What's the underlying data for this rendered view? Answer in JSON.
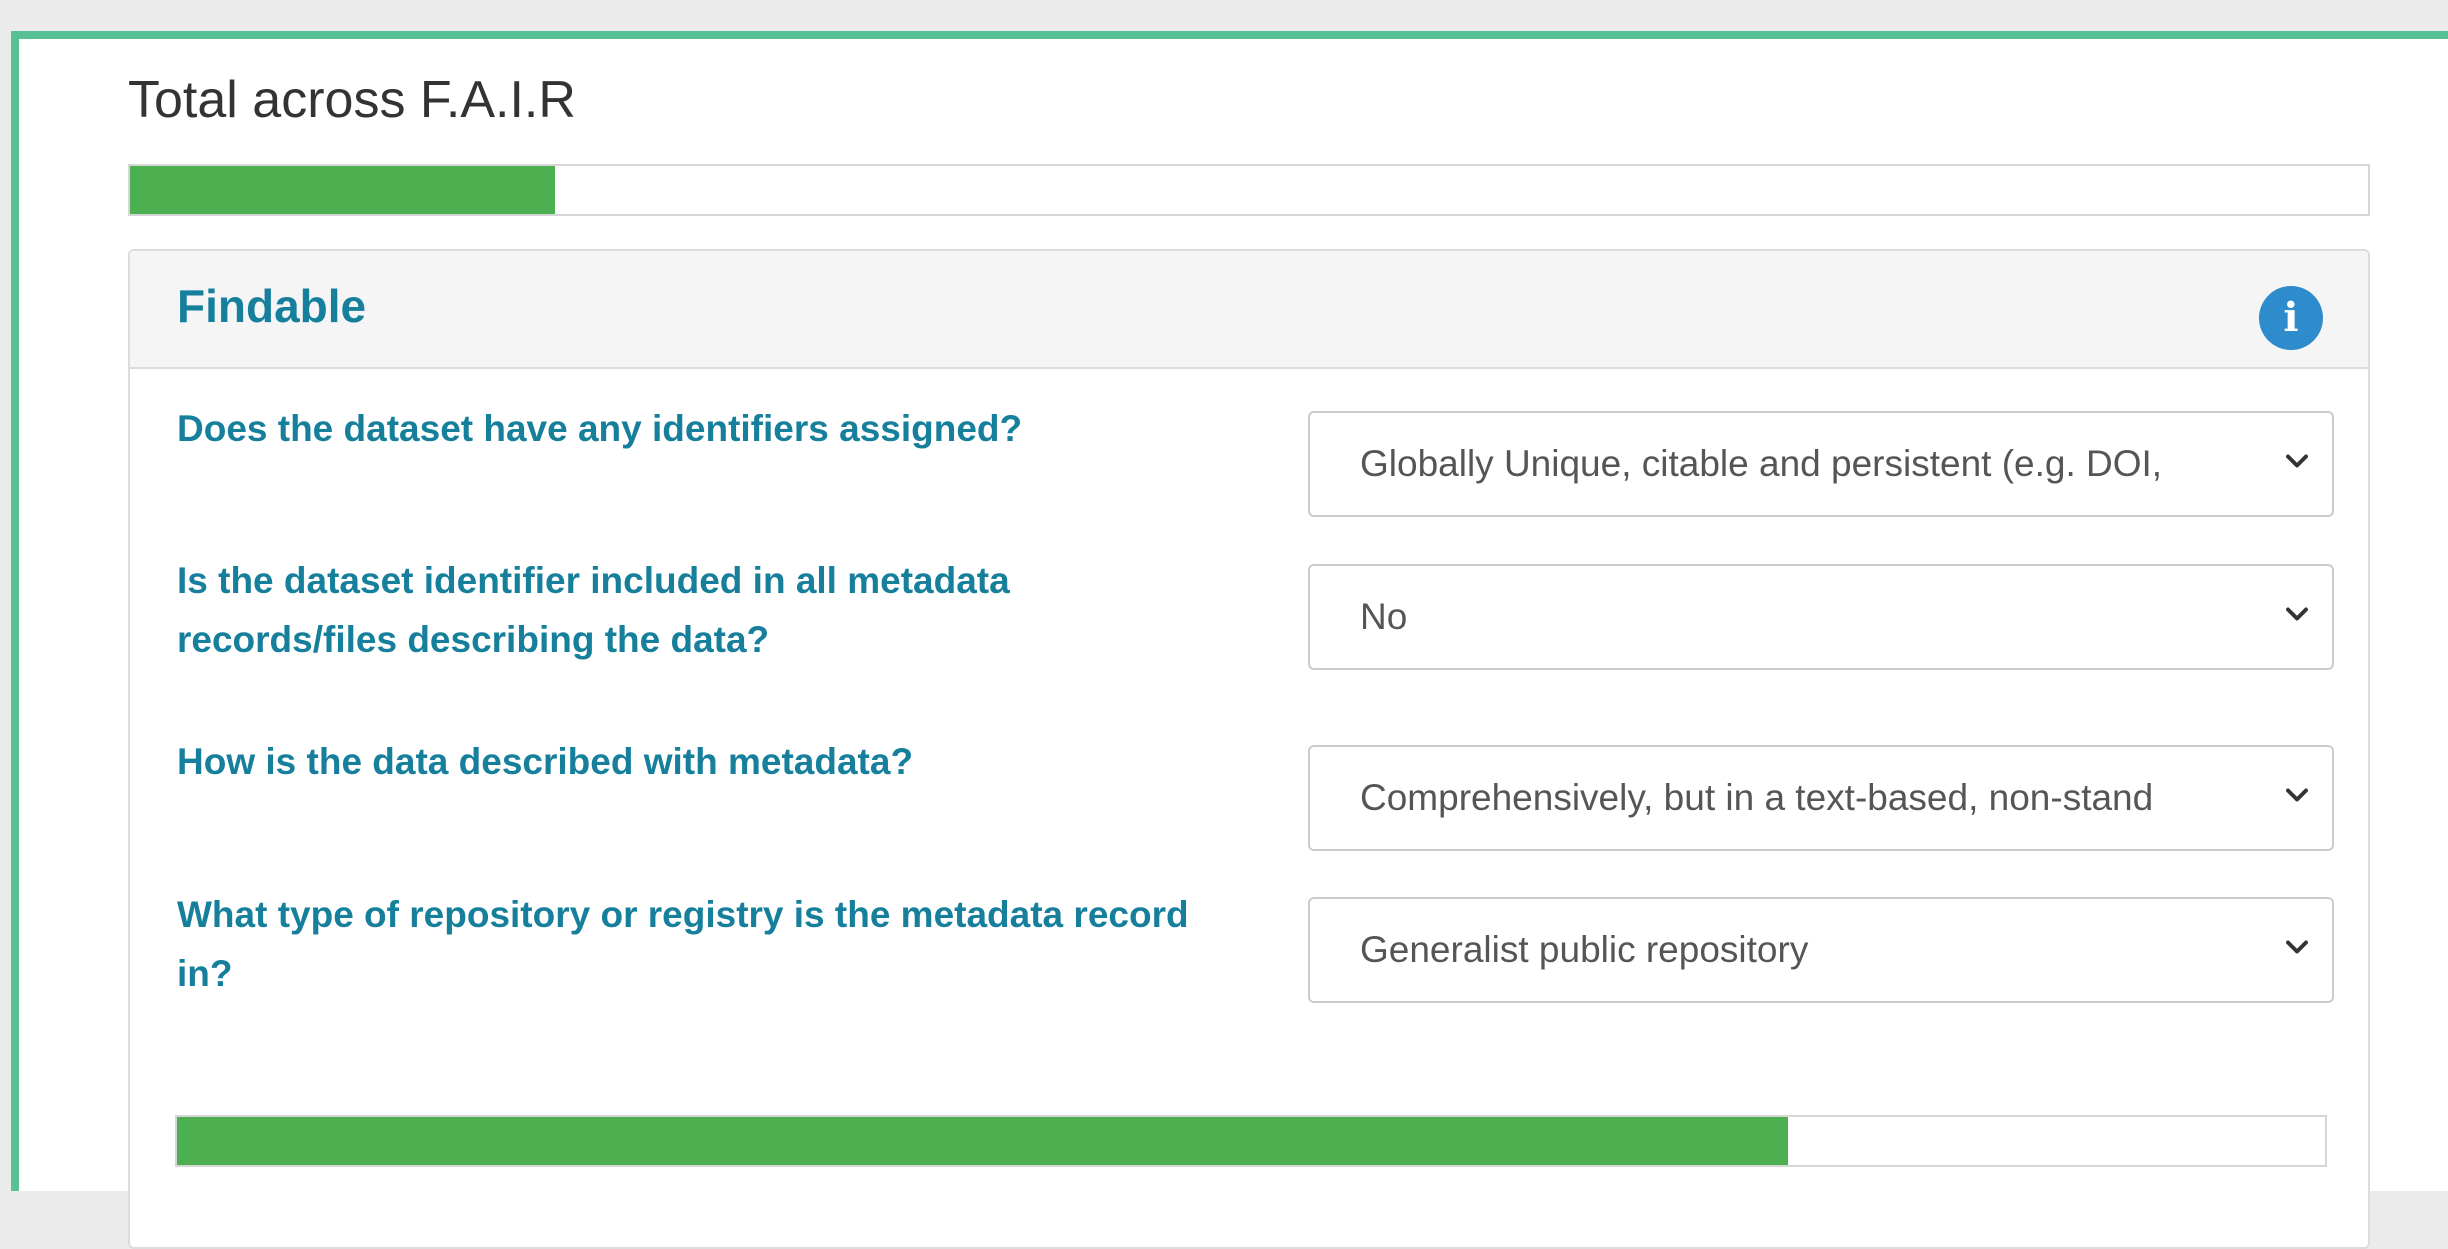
{
  "total": {
    "title": "Total across F.A.I.R",
    "progress_percent": 19
  },
  "findable": {
    "title": "Findable",
    "info_icon": "info-icon",
    "questions": [
      {
        "label": "Does the dataset have any identifiers assigned?",
        "selected": "Globally Unique, citable and persistent (e.g. DOI,"
      },
      {
        "label": "Is the dataset identifier included in all metadata records/files describing the data?",
        "selected": "No"
      },
      {
        "label": "How is the data described with metadata?",
        "selected": "Comprehensively, but in a text-based, non-stand"
      },
      {
        "label": "What type of repository or registry is the metadata record in?",
        "selected": "Generalist public repository"
      }
    ],
    "progress_percent": 75
  },
  "colors": {
    "accent": "#167f9c",
    "progress": "#4caf50",
    "frame": "#58c194",
    "info": "#2e8bcc"
  }
}
